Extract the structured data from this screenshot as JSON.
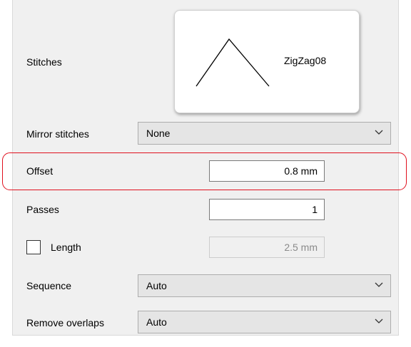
{
  "stitches": {
    "label": "Stitches",
    "pattern_name": "ZigZag08",
    "pattern_icon": "zigzag-peak-icon"
  },
  "mirror_stitches": {
    "label": "Mirror stitches",
    "value": "None"
  },
  "offset": {
    "label": "Offset",
    "value": "0.8 mm"
  },
  "passes": {
    "label": "Passes",
    "value": "1"
  },
  "length": {
    "label": "Length",
    "checked": false,
    "value": "2.5 mm",
    "enabled": false
  },
  "sequence": {
    "label": "Sequence",
    "value": "Auto"
  },
  "remove_overlaps": {
    "label": "Remove overlaps",
    "value": "Auto"
  },
  "colors": {
    "highlight": "#e0101e",
    "panel": "#f0f0f0"
  }
}
